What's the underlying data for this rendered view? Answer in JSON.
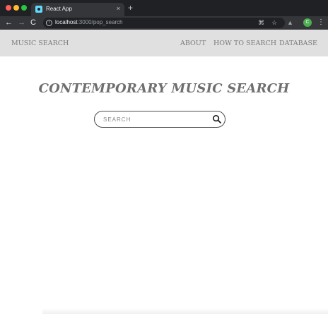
{
  "browser": {
    "tab": {
      "title": "React App",
      "favicon": "react-logo-icon",
      "close": "×"
    },
    "new_tab": "+",
    "nav": {
      "back": "←",
      "forward": "→",
      "reload": "C"
    },
    "url": {
      "host": "localhost",
      "path": ":3000/pop_search"
    },
    "profile_initial": "C",
    "colors": {
      "chrome_dark": "#202124",
      "chrome_tab": "#35363a",
      "avatar": "#4caf50"
    }
  },
  "navbar": {
    "brand": "MUSIC SEARCH",
    "links": [
      "ABOUT",
      "HOW TO SEARCH",
      "DATABASE"
    ],
    "background": "#e0e0e0"
  },
  "hero": {
    "title": "CONTEMPORARY MUSIC SEARCH"
  },
  "search": {
    "placeholder": "SEARCH",
    "value": "",
    "icon": "search-icon"
  }
}
